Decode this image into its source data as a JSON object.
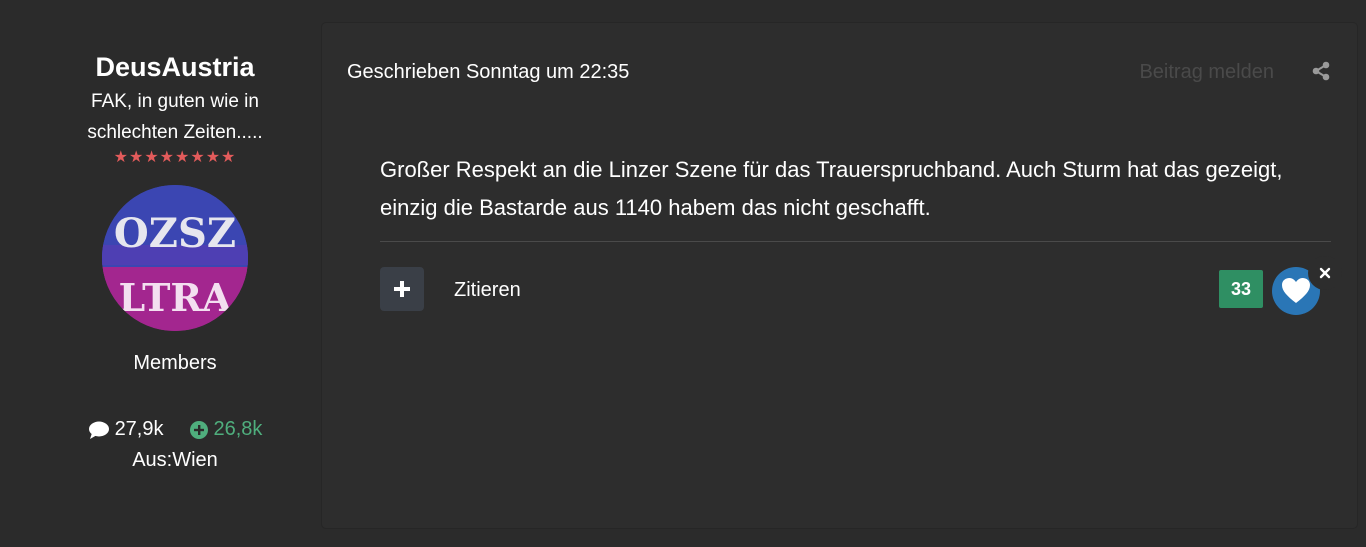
{
  "author": {
    "name": "DeusAustria",
    "title": "FAK, in guten wie in schlechten Zeiten.....",
    "stars": "★★★★★★★★",
    "avatar_text_top": "OZSZ",
    "avatar_text_bottom": "LTRA",
    "group": "Members",
    "posts_count": "27,9k",
    "reputation": "26,8k",
    "location": "Aus:Wien"
  },
  "post": {
    "meta": "Geschrieben Sonntag um 22:35",
    "report_label": "Beitrag melden",
    "share_icon": "share-icon",
    "content": "Großer Respekt an die Linzer Szene für das Trauerspruchband. Auch Sturm hat das gezeigt, einzig die Bastarde aus 1140 habem das nicht geschafft.",
    "multiquote_icon": "plus-icon",
    "quote_label": "Zitieren",
    "reaction_count": "33",
    "reaction_icon": "heart-icon",
    "reaction_remove_icon": "close-icon"
  },
  "colors": {
    "background": "#2b2b2b",
    "panel": "#2d2d2d",
    "reputation_green": "#4fae7d",
    "reaction_green": "#2f8f63",
    "heart_blue": "#2a76b6",
    "stars_red": "#e35b5b"
  }
}
